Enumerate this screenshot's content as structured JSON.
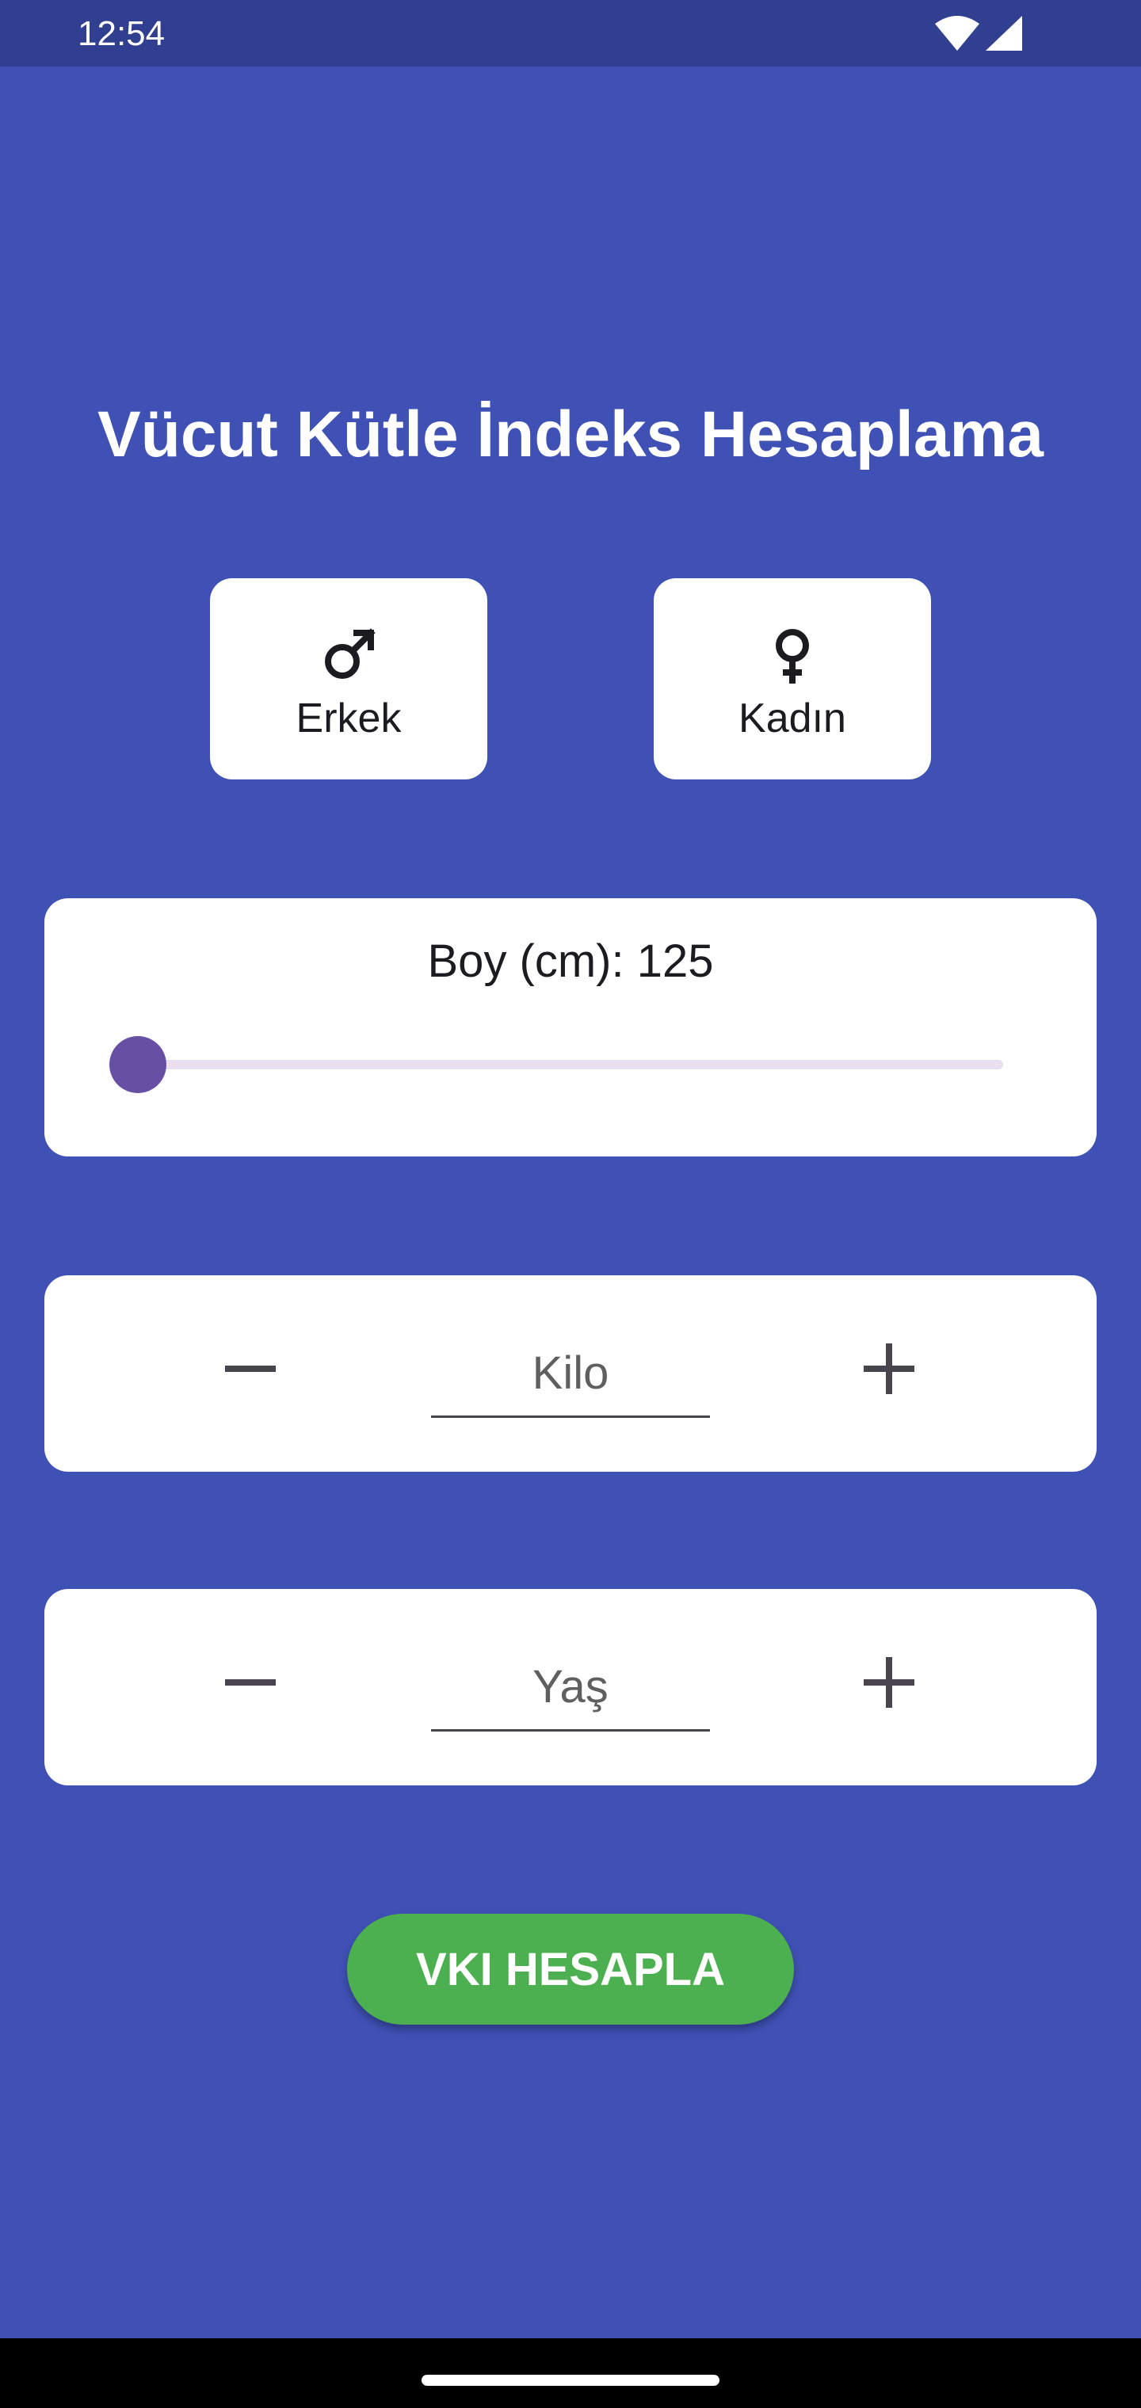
{
  "status_bar": {
    "time": "12:54",
    "icons": [
      "wifi-icon",
      "signal-icon"
    ]
  },
  "app": {
    "title": "Vücut Kütle İndeks Hesaplama",
    "gender": {
      "male_label": "Erkek",
      "female_label": "Kadın"
    },
    "height": {
      "label": "Boy (cm): 125",
      "value_cm": 125,
      "slider_fraction": 0.0
    },
    "weight": {
      "placeholder": "Kilo",
      "value": ""
    },
    "age": {
      "placeholder": "Yaş",
      "value": ""
    },
    "calculate_button": "VKI HESAPLA"
  },
  "colors": {
    "background": "#3f51b5",
    "status_bar": "#303f8f",
    "card": "#ffffff",
    "slider_thumb": "#6750a4",
    "slider_track": "#e8e0ee",
    "button": "#4caf50"
  }
}
